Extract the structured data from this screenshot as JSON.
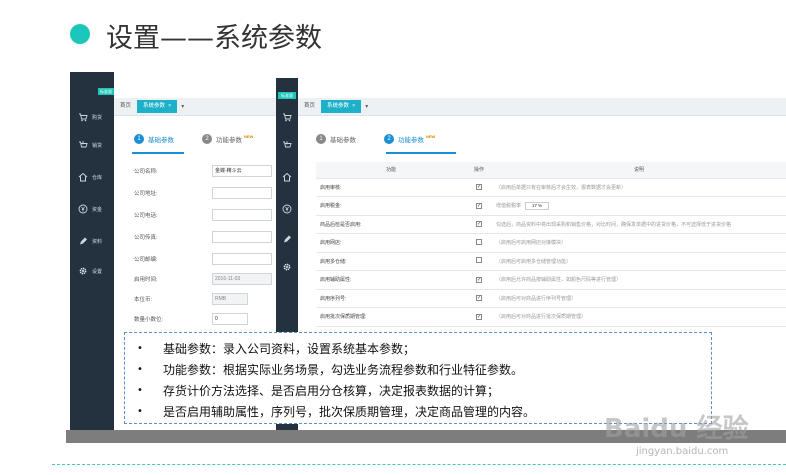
{
  "slide": {
    "title": "设置——系统参数",
    "accent_color": "#1cc7b9"
  },
  "app": {
    "brand": "标准版",
    "sidebar": [
      {
        "label": "购货",
        "icon": "cart-icon"
      },
      {
        "label": "销货",
        "icon": "cart-out-icon"
      },
      {
        "label": "仓库",
        "icon": "home-icon"
      },
      {
        "label": "资金",
        "icon": "money-icon"
      },
      {
        "label": "资料",
        "icon": "pencil-icon"
      },
      {
        "label": "设置",
        "icon": "gear-icon"
      }
    ],
    "tabs": {
      "home": "首页",
      "active": "系统参数",
      "close": "×",
      "more": "▾"
    },
    "subtabs": {
      "basic": {
        "num": "1",
        "label": "基础参数"
      },
      "function": {
        "num": "2",
        "label": "功能参数",
        "badge": "NEW"
      }
    }
  },
  "basic_form": {
    "fields": [
      {
        "label": "公司名称:",
        "value": "金蝶-精斗云"
      },
      {
        "label": "公司地址:",
        "value": ""
      },
      {
        "label": "公司电话:",
        "value": ""
      },
      {
        "label": "公司传真:",
        "value": ""
      },
      {
        "label": "公司邮编:",
        "value": ""
      },
      {
        "label": "启用时间:",
        "value": "2016-11-03"
      },
      {
        "label": "本位币:",
        "value": "RMB"
      },
      {
        "label": "数量小数位:",
        "value": "0"
      }
    ]
  },
  "function_table": {
    "headers": {
      "function": "功能",
      "op": "操作",
      "desc": "说明"
    },
    "rows": [
      {
        "name": "启用审核:",
        "checked": true,
        "desc": "（启用后单据只有在审核后才会生效，报表数据才会更新）"
      },
      {
        "name": "启用税金:",
        "checked": true,
        "desc": "增值税税率",
        "cost_value": "17 %"
      },
      {
        "name": "商品后检是否启用:",
        "checked": true,
        "desc": "勾选后，商品资料中将出现采购和销售价格，对比时间，确保发单据中的进货价格，不可选择低于进货价格"
      },
      {
        "name": "启用网店:",
        "checked": false,
        "desc": "（启用后可启用网店对接模块）"
      },
      {
        "name": "启用多仓储:",
        "checked": false,
        "desc": "（启用后可启用多仓储管理功能）"
      },
      {
        "name": "启用辅助属性:",
        "checked": true,
        "desc": "（启用后允许商品按辅助属性，如颜色尺码等进行管理）"
      },
      {
        "name": "启用序列号:",
        "checked": true,
        "desc": "（启用后可对商品进行序列号管理）"
      },
      {
        "name": "启用批次保质期管理:",
        "checked": true,
        "desc": "（启用后可对商品进行批次保质期管理）"
      }
    ]
  },
  "callout": {
    "bullet": "•",
    "items": [
      "基础参数：录入公司资料，设置系统基本参数；",
      "功能参数：根据实际业务场景，勾选业务流程参数和行业特征参数。",
      "存货计价方法选择、是否启用分仓核算，决定报表数据的计算；",
      "是否启用辅助属性，序列号，批次保质期管理，决定商品管理的内容。"
    ]
  },
  "watermark": {
    "main": "Baidu 经验",
    "sub": "jingyan.baidu.com"
  }
}
